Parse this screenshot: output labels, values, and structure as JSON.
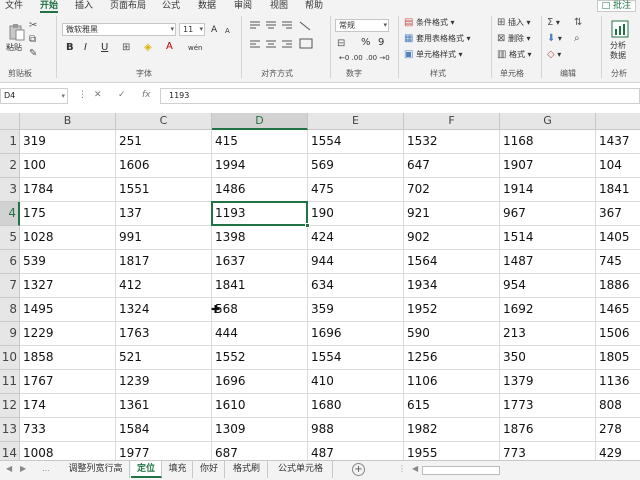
{
  "ribbon_tabs": [
    "文件",
    "开始",
    "插入",
    "页面布局",
    "公式",
    "数据",
    "审阅",
    "视图",
    "帮助"
  ],
  "active_tab": "开始",
  "comment_button": "批注",
  "clipboard": {
    "paste_label": "粘贴",
    "group_label": "剪贴板"
  },
  "font": {
    "name": "微软雅黑",
    "size": "11",
    "group_label": "字体",
    "bold": "B",
    "italic": "I",
    "underline": "U",
    "grow": "A",
    "shrink": "A",
    "color_glyph": "A",
    "phonetic": "wén"
  },
  "alignment": {
    "group_label": "对齐方式"
  },
  "number": {
    "format": "常规",
    "group_label": "数字",
    "percent": "%",
    "comma": "9"
  },
  "styles": {
    "conditional": "条件格式",
    "table_format": "套用表格格式",
    "cell_styles": "单元格样式",
    "group_label": "样式"
  },
  "cells": {
    "insert": "插入",
    "delete": "删除",
    "format": "格式",
    "group_label": "单元格"
  },
  "editing": {
    "group_label": "编辑"
  },
  "analysis": {
    "label1": "分析",
    "label2": "数据",
    "group_label": "分析"
  },
  "formula_bar": {
    "name_box": "D4",
    "fx": "fx",
    "value": "1193"
  },
  "columns": [
    "B",
    "C",
    "D",
    "E",
    "F",
    "G",
    "H"
  ],
  "selected_column": "D",
  "selected_row": "4",
  "rows": [
    {
      "num": "1",
      "cells": [
        "319",
        "251",
        "415",
        "1554",
        "1532",
        "1168",
        "1437"
      ]
    },
    {
      "num": "2",
      "cells": [
        "100",
        "1606",
        "1994",
        "569",
        "647",
        "1907",
        "104"
      ]
    },
    {
      "num": "3",
      "cells": [
        "1784",
        "1551",
        "1486",
        "475",
        "702",
        "1914",
        "1841"
      ]
    },
    {
      "num": "4",
      "cells": [
        "175",
        "137",
        "1193",
        "190",
        "921",
        "967",
        "367"
      ]
    },
    {
      "num": "5",
      "cells": [
        "1028",
        "991",
        "1398",
        "424",
        "902",
        "1514",
        "1405"
      ]
    },
    {
      "num": "6",
      "cells": [
        "539",
        "1817",
        "1637",
        "944",
        "1564",
        "1487",
        "745"
      ]
    },
    {
      "num": "7",
      "cells": [
        "1327",
        "412",
        "1841",
        "634",
        "1934",
        "954",
        "1886"
      ]
    },
    {
      "num": "8",
      "cells": [
        "1495",
        "1324",
        "568",
        "359",
        "1952",
        "1692",
        "1465"
      ]
    },
    {
      "num": "9",
      "cells": [
        "1229",
        "1763",
        "444",
        "1696",
        "590",
        "213",
        "1506"
      ]
    },
    {
      "num": "10",
      "cells": [
        "1858",
        "521",
        "1552",
        "1554",
        "1256",
        "350",
        "1805"
      ]
    },
    {
      "num": "11",
      "cells": [
        "1767",
        "1239",
        "1696",
        "410",
        "1106",
        "1379",
        "1136"
      ]
    },
    {
      "num": "12",
      "cells": [
        "174",
        "1361",
        "1610",
        "1680",
        "615",
        "1773",
        "808"
      ]
    },
    {
      "num": "13",
      "cells": [
        "733",
        "1584",
        "1309",
        "988",
        "1982",
        "1876",
        "278"
      ]
    },
    {
      "num": "14",
      "cells": [
        "1008",
        "1977",
        "687",
        "487",
        "1955",
        "773",
        "429"
      ]
    }
  ],
  "sheet_tabs": [
    "调整列宽行高",
    "定位",
    "填充",
    "你好",
    "格式刷",
    "公式单元格"
  ],
  "active_sheet": "定位",
  "add_sheet": "+",
  "colors": {
    "accent": "#217346",
    "header_bg": "#e6e6e6",
    "ribbon_bg": "#f3f3f3"
  }
}
